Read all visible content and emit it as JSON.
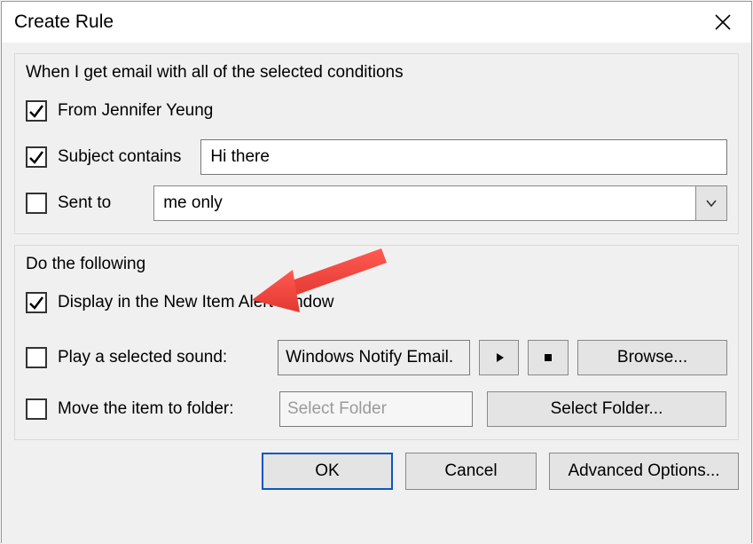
{
  "title": "Create Rule",
  "conditions": {
    "caption": "When I get email with all of the selected conditions",
    "from_label": "From Jennifer Yeung",
    "subject_label": "Subject contains",
    "subject_value": "Hi there",
    "sent_to_label": "Sent to",
    "sent_to_value": "me only"
  },
  "actions": {
    "caption": "Do the following",
    "display_alert_label": "Display in the New Item Alert window",
    "play_sound_label": "Play a selected sound:",
    "sound_file": "Windows Notify Email.",
    "browse_label": "Browse...",
    "move_label": "Move the item to folder:",
    "folder_placeholder": "Select Folder",
    "select_folder_label": "Select Folder..."
  },
  "buttons": {
    "ok": "OK",
    "cancel": "Cancel",
    "advanced": "Advanced Options..."
  }
}
